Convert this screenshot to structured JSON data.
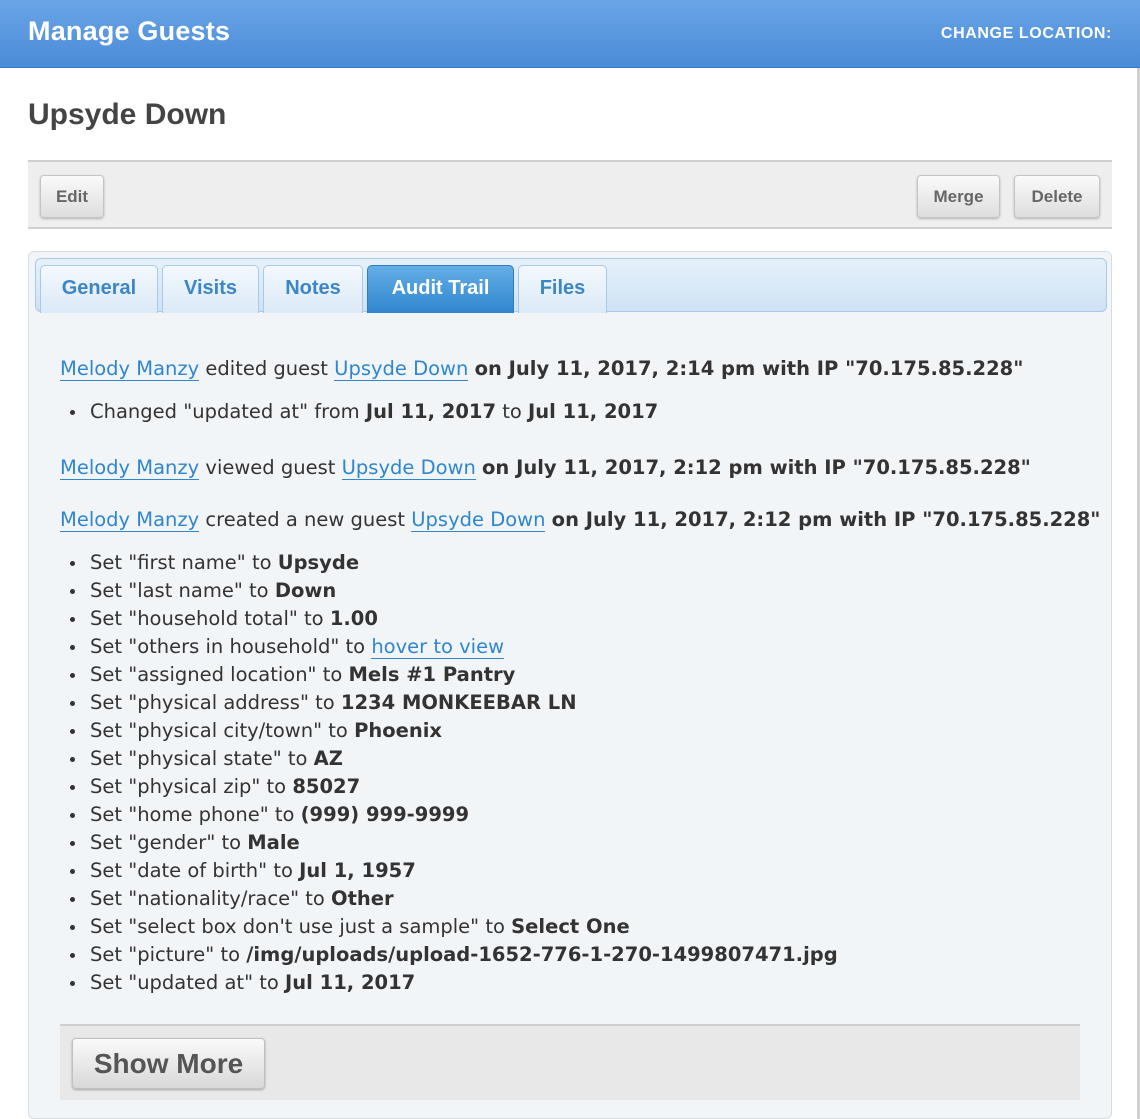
{
  "header": {
    "app_title": "Manage Guests",
    "change_location": "CHANGE LOCATION:"
  },
  "page": {
    "title": "Upsyde Down"
  },
  "toolbar": {
    "edit": "Edit",
    "merge": "Merge",
    "delete": "Delete"
  },
  "tabs": [
    {
      "label": "General",
      "active": false
    },
    {
      "label": "Visits",
      "active": false
    },
    {
      "label": "Notes",
      "active": false
    },
    {
      "label": "Audit Trail",
      "active": true
    },
    {
      "label": "Files",
      "active": false
    }
  ],
  "audit": [
    {
      "user": "Melody Manzy",
      "action": "edited guest",
      "target": "Upsyde Down",
      "details": "on July 11, 2017, 2:14 pm with IP \"70.175.85.228\"",
      "changes": [
        {
          "prefix": "Changed \"updated at\" from ",
          "from": "Jul 11, 2017",
          "mid": " to ",
          "to": "Jul 11, 2017"
        }
      ]
    },
    {
      "user": "Melody Manzy",
      "action": "viewed guest",
      "target": "Upsyde Down",
      "details": "on July 11, 2017, 2:12 pm with IP \"70.175.85.228\"",
      "changes": []
    },
    {
      "user": "Melody Manzy",
      "action": "created a new guest",
      "target": "Upsyde Down",
      "details": "on July 11, 2017, 2:12 pm with IP \"70.175.85.228\"",
      "changes": [
        {
          "prefix": "Set \"first name\" to ",
          "value": "Upsyde"
        },
        {
          "prefix": "Set \"last name\" to ",
          "value": "Down"
        },
        {
          "prefix": "Set \"household total\" to ",
          "value": "1.00"
        },
        {
          "prefix": "Set \"others in household\" to ",
          "link": "hover to view"
        },
        {
          "prefix": "Set \"assigned location\" to ",
          "value": "Mels #1 Pantry"
        },
        {
          "prefix": "Set \"physical address\" to ",
          "value": "1234 MONKEEBAR LN"
        },
        {
          "prefix": "Set \"physical city/town\" to ",
          "value": "Phoenix"
        },
        {
          "prefix": "Set \"physical state\" to ",
          "value": "AZ"
        },
        {
          "prefix": "Set \"physical zip\" to ",
          "value": "85027"
        },
        {
          "prefix": "Set \"home phone\" to ",
          "value": "(999) 999-9999"
        },
        {
          "prefix": "Set \"gender\" to ",
          "value": "Male"
        },
        {
          "prefix": "Set \"date of birth\" to ",
          "value": "Jul 1, 1957"
        },
        {
          "prefix": "Set \"nationality/race\" to ",
          "value": "Other"
        },
        {
          "prefix": "Set \"select box don't use just a sample\" to ",
          "value": "Select One"
        },
        {
          "prefix": "Set \"picture\" to ",
          "value": "/img/uploads/upload-1652-776-1-270-1499807471.jpg"
        },
        {
          "prefix": "Set \"updated at\" to ",
          "value": "Jul 11, 2017"
        }
      ]
    }
  ],
  "show_more": "Show More"
}
